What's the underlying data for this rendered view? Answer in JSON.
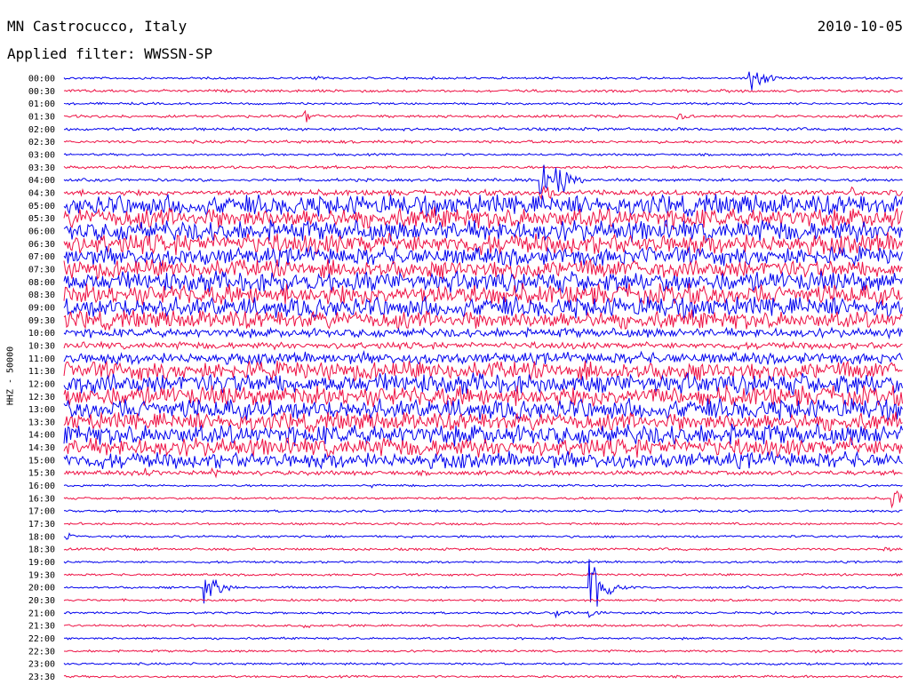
{
  "header": {
    "station": "MN Castrocucco, Italy",
    "date": "2010-10-05",
    "filter": "Applied filter: WWSSN-SP"
  },
  "chart_data": {
    "type": "line",
    "title": "MN Castrocucco, Italy",
    "ylabel": "HHZ - 50000",
    "colors": [
      "#0000ee",
      "#ee1144"
    ],
    "rows": [
      {
        "label": "00:00",
        "amp": 1,
        "events": [
          {
            "x": 0.3,
            "a": 3
          },
          {
            "x": 0.82,
            "a": 20
          }
        ]
      },
      {
        "label": "00:30",
        "amp": 1.2,
        "events": []
      },
      {
        "label": "01:00",
        "amp": 1,
        "events": [
          {
            "x": 0.81,
            "a": 3
          }
        ]
      },
      {
        "label": "01:30",
        "amp": 1.2,
        "events": [
          {
            "x": 0.29,
            "a": 7
          },
          {
            "x": 0.73,
            "a": 6
          }
        ]
      },
      {
        "label": "02:00",
        "amp": 1.3,
        "events": []
      },
      {
        "label": "02:30",
        "amp": 1.3,
        "events": [
          {
            "x": 0.31,
            "a": 3
          }
        ]
      },
      {
        "label": "03:00",
        "amp": 1,
        "events": []
      },
      {
        "label": "03:30",
        "amp": 1.3,
        "events": []
      },
      {
        "label": "04:00",
        "amp": 1.3,
        "events": [
          {
            "x": 0.57,
            "a": 25
          },
          {
            "x": 0.59,
            "a": 30
          }
        ]
      },
      {
        "label": "04:30",
        "amp": 2.5,
        "events": [
          {
            "x": 0.57,
            "a": 14
          },
          {
            "x": 0.94,
            "a": 8
          }
        ]
      },
      {
        "label": "05:00",
        "amp": 9,
        "events": []
      },
      {
        "label": "05:30",
        "amp": 9,
        "events": []
      },
      {
        "label": "06:00",
        "amp": 9,
        "events": []
      },
      {
        "label": "06:30",
        "amp": 9,
        "events": []
      },
      {
        "label": "07:00",
        "amp": 8,
        "events": []
      },
      {
        "label": "07:30",
        "amp": 8,
        "events": []
      },
      {
        "label": "08:00",
        "amp": 9,
        "events": []
      },
      {
        "label": "08:30",
        "amp": 9,
        "events": []
      },
      {
        "label": "09:00",
        "amp": 9,
        "events": []
      },
      {
        "label": "09:30",
        "amp": 8,
        "events": []
      },
      {
        "label": "10:00",
        "amp": 4,
        "events": []
      },
      {
        "label": "10:30",
        "amp": 3,
        "events": []
      },
      {
        "label": "11:00",
        "amp": 5,
        "events": []
      },
      {
        "label": "11:30",
        "amp": 8,
        "events": []
      },
      {
        "label": "12:00",
        "amp": 9,
        "events": [
          {
            "x": 0.58,
            "a": 14
          }
        ]
      },
      {
        "label": "12:30",
        "amp": 9,
        "events": [
          {
            "x": 0.7,
            "a": 10
          }
        ]
      },
      {
        "label": "13:00",
        "amp": 9,
        "events": []
      },
      {
        "label": "13:30",
        "amp": 8,
        "events": []
      },
      {
        "label": "14:00",
        "amp": 9,
        "events": []
      },
      {
        "label": "14:30",
        "amp": 8,
        "events": []
      },
      {
        "label": "15:00",
        "amp": 7,
        "events": []
      },
      {
        "label": "15:30",
        "amp": 2,
        "events": [
          {
            "x": 0.1,
            "a": 6
          },
          {
            "x": 0.18,
            "a": 6
          }
        ]
      },
      {
        "label": "16:00",
        "amp": 1,
        "events": [
          {
            "x": 0.37,
            "a": 3
          },
          {
            "x": 0.42,
            "a": 3
          }
        ]
      },
      {
        "label": "16:30",
        "amp": 1,
        "events": [
          {
            "x": 0.99,
            "a": 12
          }
        ]
      },
      {
        "label": "17:00",
        "amp": 1,
        "events": []
      },
      {
        "label": "17:30",
        "amp": 1,
        "events": []
      },
      {
        "label": "18:00",
        "amp": 1,
        "events": [
          {
            "x": 0.005,
            "a": 6
          }
        ]
      },
      {
        "label": "18:30",
        "amp": 1.1,
        "events": [
          {
            "x": 0.98,
            "a": 3
          }
        ]
      },
      {
        "label": "19:00",
        "amp": 1,
        "events": []
      },
      {
        "label": "19:30",
        "amp": 1,
        "events": []
      },
      {
        "label": "20:00",
        "amp": 1,
        "events": [
          {
            "x": 0.17,
            "a": 24
          },
          {
            "x": 0.63,
            "a": 40
          }
        ]
      },
      {
        "label": "20:30",
        "amp": 1,
        "events": []
      },
      {
        "label": "21:00",
        "amp": 1,
        "events": [
          {
            "x": 0.59,
            "a": 5
          },
          {
            "x": 0.63,
            "a": 6
          }
        ]
      },
      {
        "label": "21:30",
        "amp": 1,
        "events": [
          {
            "x": 0.29,
            "a": 3
          }
        ]
      },
      {
        "label": "22:00",
        "amp": 1,
        "events": []
      },
      {
        "label": "22:30",
        "amp": 1,
        "events": [
          {
            "x": 0.9,
            "a": 3
          }
        ]
      },
      {
        "label": "23:00",
        "amp": 1,
        "events": []
      },
      {
        "label": "23:30",
        "amp": 1,
        "events": []
      }
    ]
  }
}
